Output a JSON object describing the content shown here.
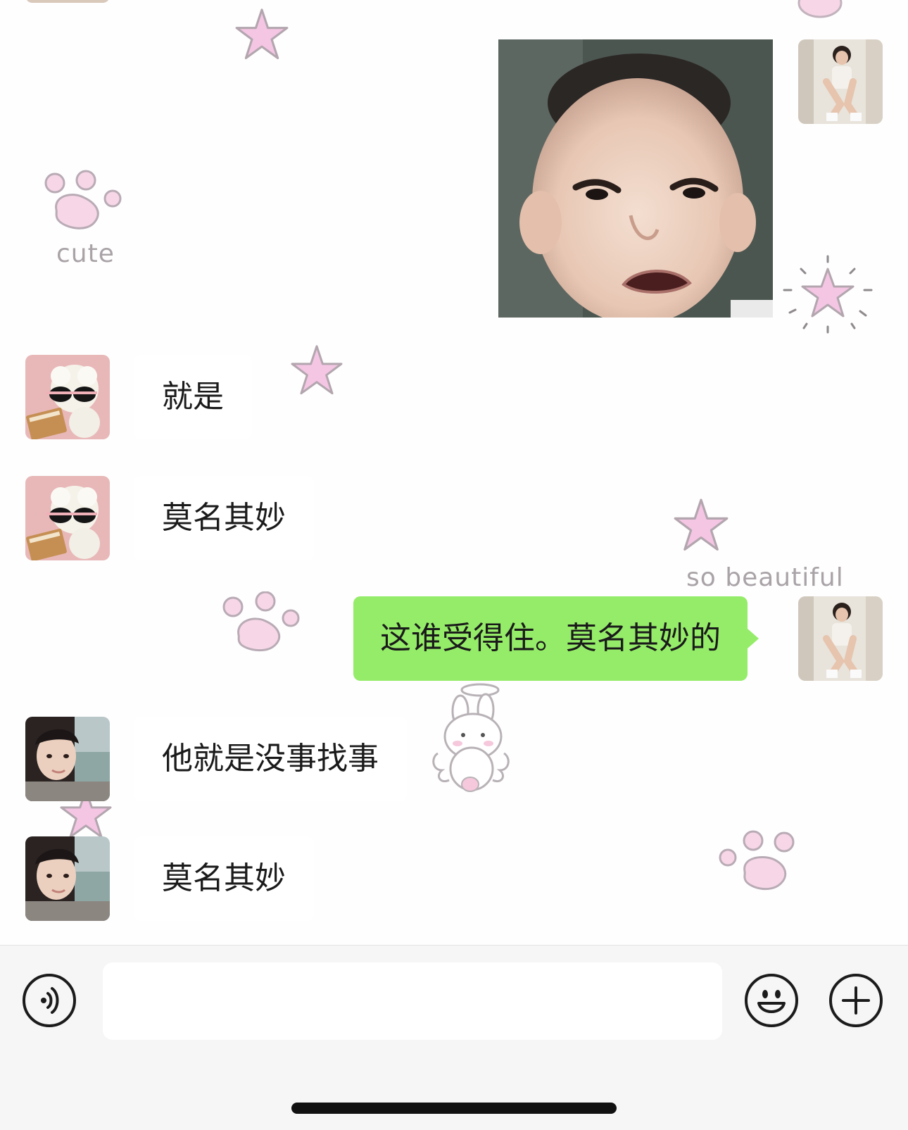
{
  "decorations": {
    "cute_label": "cute",
    "beautiful_label": "so beautiful"
  },
  "messages": [
    {
      "id": "m1",
      "side": "right",
      "type": "image",
      "image_desc_icon": "crying-baby-photo",
      "avatar": "girl-sitting-avatar"
    },
    {
      "id": "m2",
      "side": "left",
      "type": "text",
      "text": "就是",
      "avatar": "sheep-sunglasses-avatar"
    },
    {
      "id": "m3",
      "side": "left",
      "type": "text",
      "text": "莫名其妙",
      "avatar": "sheep-sunglasses-avatar"
    },
    {
      "id": "m4",
      "side": "right",
      "type": "text",
      "text": "这谁受得住。莫名其妙的",
      "avatar": "girl-sitting-avatar"
    },
    {
      "id": "m5",
      "side": "left",
      "type": "text",
      "text": "他就是没事找事",
      "avatar": "girl-portrait-avatar"
    },
    {
      "id": "m6",
      "side": "left",
      "type": "text",
      "text": "莫名其妙",
      "avatar": "girl-portrait-avatar"
    }
  ],
  "input_bar": {
    "voice_icon": "voice-icon",
    "input_value": "",
    "emoji_icon": "emoji-icon",
    "plus_icon": "plus-icon"
  },
  "colors": {
    "outgoing_bubble": "#95ec69",
    "incoming_bubble": "#ffffff",
    "decoration_pink": "#f6d2e6",
    "decoration_outline": "#b7a9b3"
  }
}
